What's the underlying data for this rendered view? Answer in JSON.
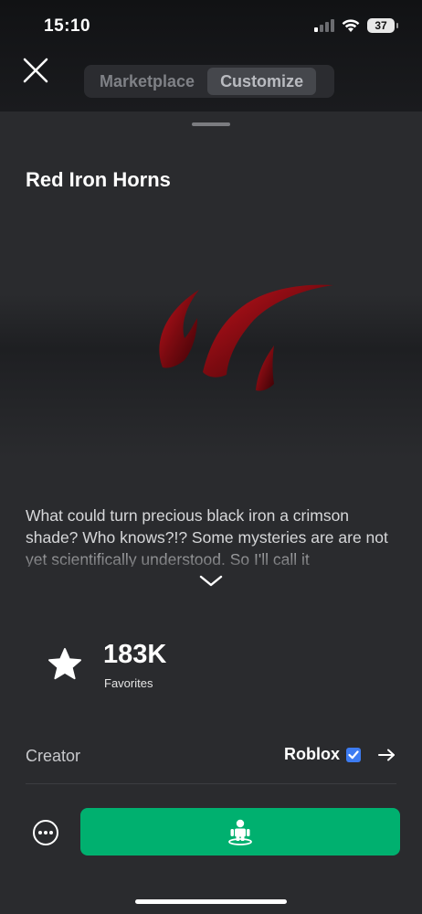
{
  "status_bar": {
    "time": "15:10",
    "battery": "37",
    "icons": [
      "signal-icon",
      "wifi-icon",
      "battery-icon"
    ]
  },
  "nav": {
    "close_icon": "close-icon",
    "tabs": [
      {
        "label": "Marketplace",
        "active": false
      },
      {
        "label": "Customize",
        "active": true
      }
    ]
  },
  "item": {
    "title": "Red Iron Horns",
    "image": "red-iron-horns",
    "description": "What could turn precious black iron a crimson shade? Who knows?!? Some mysteries are are not yet scientifically understood. So I'll call it",
    "expand_icon": "chevron-down-icon"
  },
  "stats": {
    "favorites_count": "183K",
    "favorites_label": "Favorites",
    "icon": "star-icon"
  },
  "creator": {
    "label": "Creator",
    "name": "Roblox",
    "verified": true,
    "arrow_icon": "arrow-right-icon"
  },
  "actions": {
    "more_icon": "more-icon",
    "try_on_icon": "avatar-try-on-icon"
  },
  "colors": {
    "accent_green": "#00b06f",
    "verified_blue": "#3d7cf2",
    "horn_red": "#8a0c12"
  }
}
